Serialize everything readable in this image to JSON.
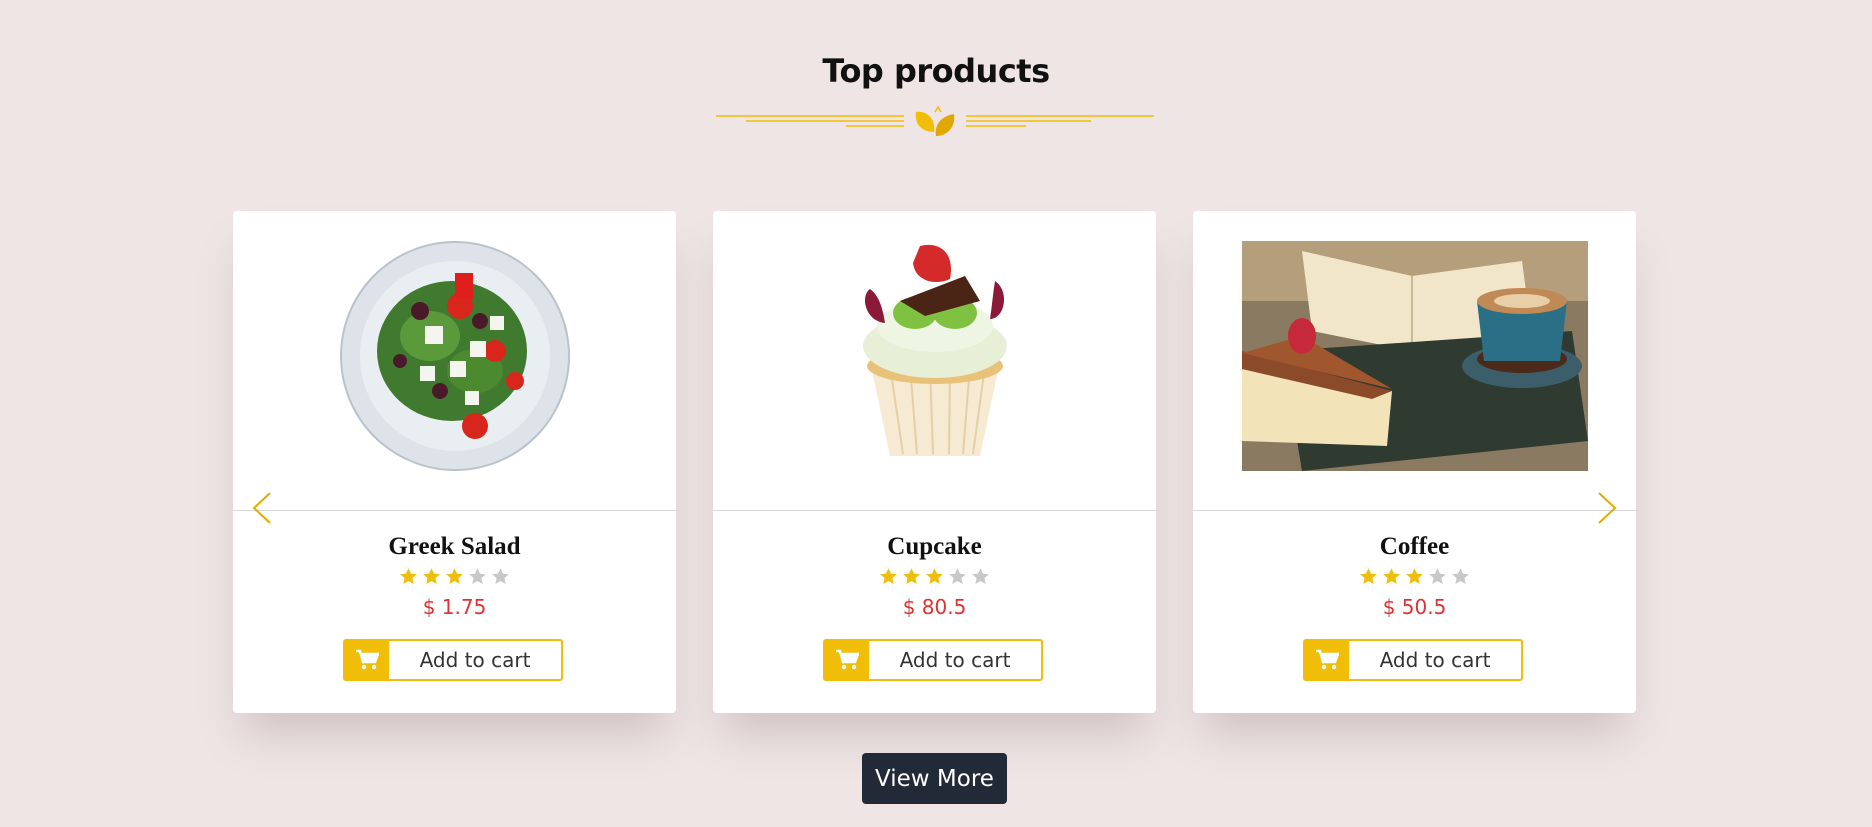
{
  "section": {
    "title": "Top products"
  },
  "colors": {
    "accent": "#f0be08",
    "price": "#e03131",
    "button_dark": "#222a38",
    "background": "#efe5e5"
  },
  "products": [
    {
      "name": "Greek Salad",
      "price": "$ 1.75",
      "rating": 3,
      "rating_max": 5,
      "image": "greek-salad-plate",
      "cart_label": "Add to cart"
    },
    {
      "name": "Cupcake",
      "price": "$ 80.5",
      "rating": 3,
      "rating_max": 5,
      "image": "cupcake",
      "cart_label": "Add to cart"
    },
    {
      "name": "Coffee",
      "price": "$ 50.5",
      "rating": 3,
      "rating_max": 5,
      "image": "coffee-and-cake",
      "cart_label": "Add to cart"
    }
  ],
  "carousel": {
    "prev_icon": "chevron-left-icon",
    "next_icon": "chevron-right-icon"
  },
  "view_more_label": "View More"
}
